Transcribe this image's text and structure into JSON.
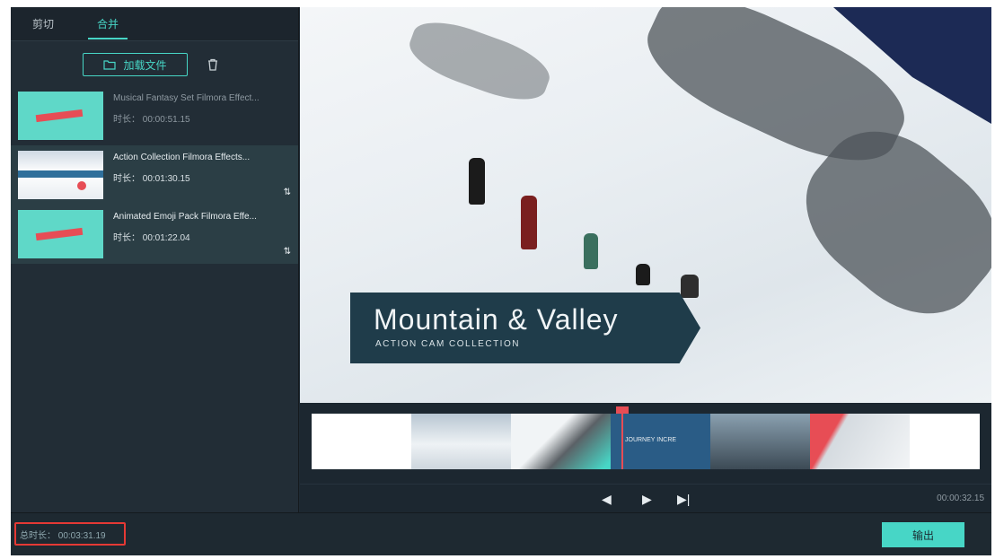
{
  "tabs": [
    {
      "label": "剪切"
    },
    {
      "label": "合并",
      "active": true
    }
  ],
  "toolbar": {
    "add_file_label": "加载文件"
  },
  "files": [
    {
      "title": "Musical Fantasy Set Filmora Effect...",
      "duration": "时长： 00:00:51.15",
      "selected": false
    },
    {
      "title": "Action Collection Filmora Effects...",
      "duration": "时长： 00:01:30.15",
      "selected": true
    },
    {
      "title": "Animated Emoji Pack Filmora Effe...",
      "duration": "时长： 00:01:22.04",
      "selected": true
    }
  ],
  "preview": {
    "banner_title": "Mountain & Valley",
    "banner_subtitle": "ACTION CAM COLLECTION"
  },
  "filmstrip": {
    "center_label": "JOURNEY INCRE"
  },
  "player": {
    "current_time": "00:00:32.15"
  },
  "footer": {
    "total_duration": "总时长： 00:03:31.19",
    "export_label": "输出"
  },
  "colors": {
    "accent": "#47d6c6",
    "highlight_border": "#e53935",
    "playhead": "#e74d55"
  },
  "icons": [
    "folder-icon",
    "trash-icon",
    "sort-icon",
    "prev-frame-icon",
    "play-icon",
    "next-frame-icon"
  ]
}
